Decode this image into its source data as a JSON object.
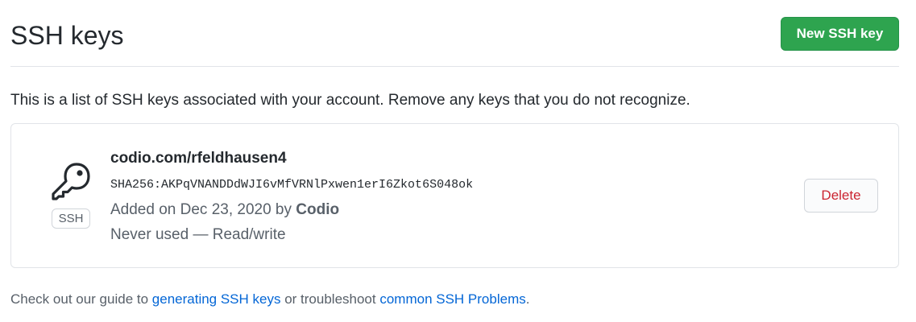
{
  "header": {
    "title": "SSH keys",
    "new_key_label": "New SSH key"
  },
  "intro_text": "This is a list of SSH keys associated with your account. Remove any keys that you do not recognize.",
  "keys": [
    {
      "icon": "key-icon",
      "type_badge": "SSH",
      "title": "codio.com/rfeldhausen4",
      "fingerprint": "SHA256:AKPqVNANDDdWJI6vMfVRNlPxwen1erI6Zkot6S048ok",
      "added_prefix": "Added on Dec 23, 2020 by ",
      "added_by": "Codio",
      "usage": "Never used — Read/write",
      "delete_label": "Delete"
    }
  ],
  "footer": {
    "prefix": "Check out our guide to ",
    "guide_link": "generating SSH keys",
    "middle": " or troubleshoot ",
    "problems_link": "common SSH Problems",
    "suffix": "."
  },
  "colors": {
    "primary_button": "#2ea44f",
    "danger_text": "#cb2431",
    "link": "#0366d6",
    "muted_text": "#586069",
    "border": "#e1e4e8"
  }
}
